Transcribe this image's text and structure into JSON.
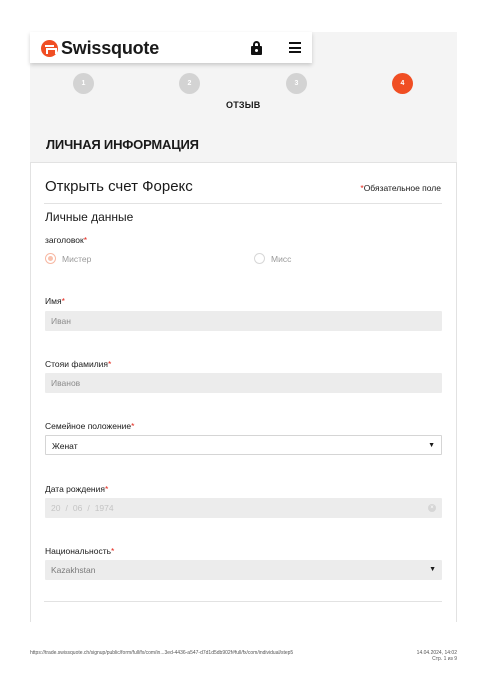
{
  "header": {
    "logo_text": "Swissquote"
  },
  "steps": {
    "items": [
      {
        "number": "1",
        "active": false
      },
      {
        "number": "2",
        "active": false
      },
      {
        "number": "3",
        "active": false
      },
      {
        "number": "4",
        "active": true
      }
    ],
    "active_label": "ОТЗЫВ"
  },
  "section_title": "ЛИЧНАЯ ИНФОРМАЦИЯ",
  "form": {
    "title": "Открыть счет Форекс",
    "required_note": "Обязательное поле",
    "required_mark": "*",
    "subtitle": "Личные данные",
    "salutation": {
      "label": "заголовок",
      "options": [
        {
          "label": "Мистер",
          "checked": true
        },
        {
          "label": "Мисс",
          "checked": false
        }
      ]
    },
    "first_name": {
      "label": "Имя",
      "value": "Иван"
    },
    "last_name": {
      "label": "Стояи фамилия",
      "value": "Иванов"
    },
    "marital_status": {
      "label": "Семейное положение",
      "value": "Женат"
    },
    "birth_date": {
      "label": "Дата рождения",
      "day": "20",
      "month": "06",
      "year": "1974",
      "separator": "/"
    },
    "nationality": {
      "label": "Национальность",
      "value": "Kazakhstan"
    }
  },
  "footer": {
    "url": "https://trade.swissquote.ch/signup/public/form/full/fx/com/in...3ed-4436-a547-d7d1d5db902f#full/fx/com/individual/step5",
    "date": "14.04.2024, 14:02",
    "page": "Стр. 1 из 9"
  },
  "colors": {
    "accent": "#f04e23",
    "required": "#e3261b",
    "step_inactive": "#d3d3d3"
  },
  "icons": {
    "logo": "swissquote-logo-icon",
    "lock": "lock-icon",
    "menu": "hamburger-menu-icon",
    "dropdown": "chevron-down-icon",
    "clear": "clear-icon"
  }
}
